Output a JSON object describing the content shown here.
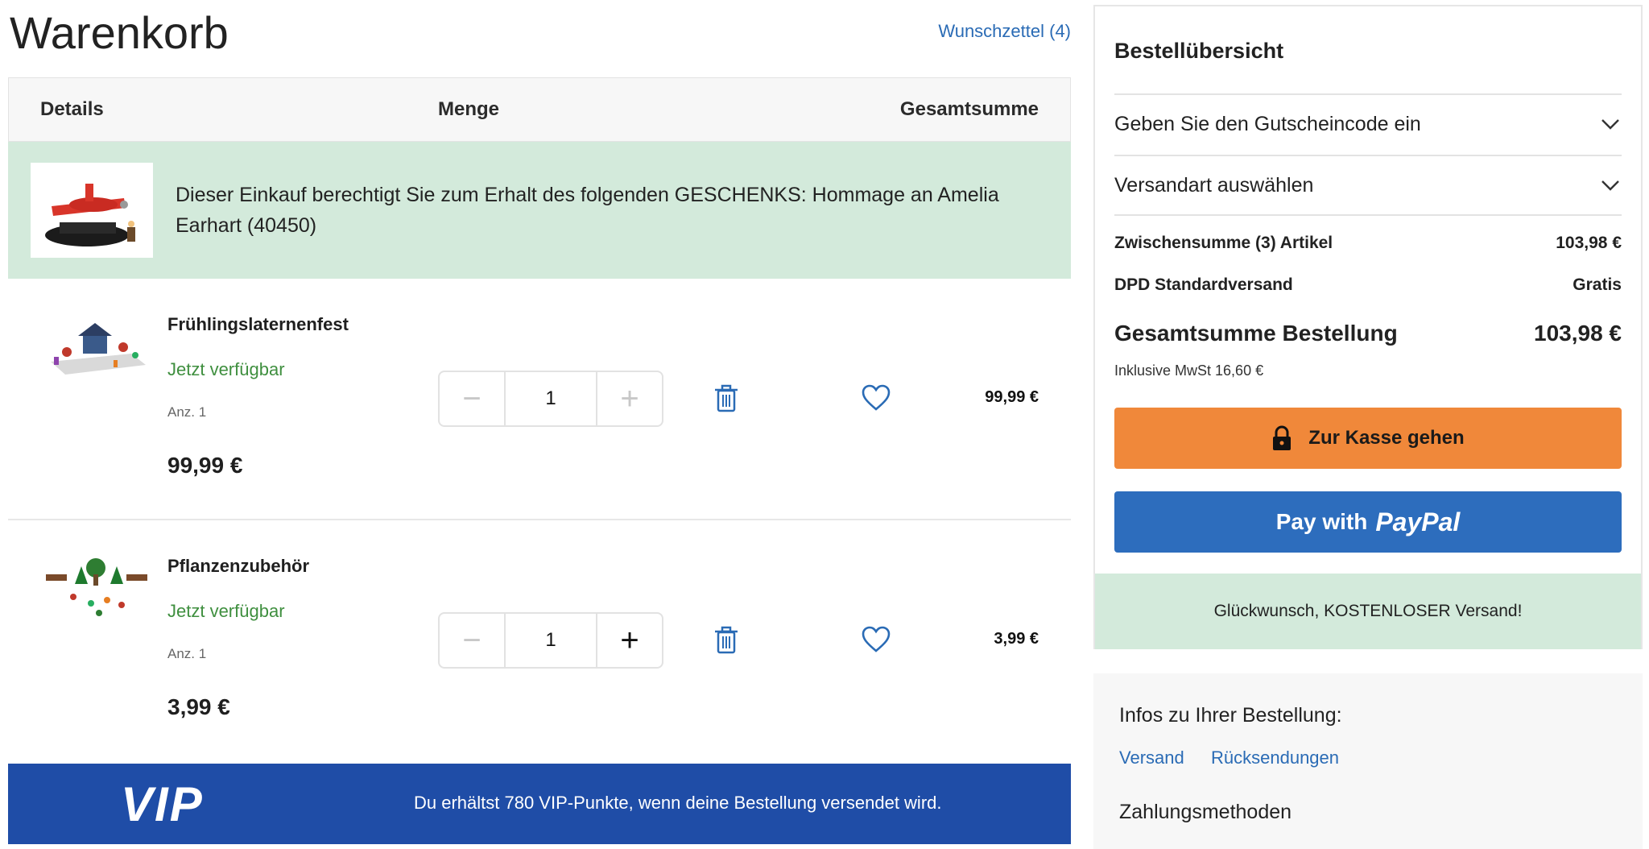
{
  "page": {
    "title": "Warenkorb",
    "wishlist": "Wunschzettel (4)"
  },
  "table": {
    "headers": {
      "details": "Details",
      "quantity": "Menge",
      "total": "Gesamtsumme"
    },
    "gift_banner": "Dieser Einkauf berechtigt Sie zum Erhalt des folgenden GESCHENKS: Hommage an Amelia Earhart (40450)",
    "items": [
      {
        "name": "Frühlingslaternenfest",
        "availability": "Jetzt verfügbar",
        "qty_label": "Anz. 1",
        "price": "99,99 €",
        "quantity": "1",
        "line_total": "99,99 €",
        "minus_enabled": false,
        "plus_enabled": false
      },
      {
        "name": "Pflanzenzubehör",
        "availability": "Jetzt verfügbar",
        "qty_label": "Anz. 1",
        "price": "3,99 €",
        "quantity": "1",
        "line_total": "3,99 €",
        "minus_enabled": false,
        "plus_enabled": true
      }
    ]
  },
  "vip": {
    "logo": "VIP",
    "text": "Du erhältst 780 VIP-Punkte, wenn deine Bestellung versendet wird."
  },
  "summary": {
    "title": "Bestellübersicht",
    "coupon": "Geben Sie den Gutscheincode ein",
    "shipping_select": "Versandart auswählen",
    "subtotal_label": "Zwischensumme (3) Artikel",
    "subtotal_value": "103,98 €",
    "shipping_label": "DPD Standardversand",
    "shipping_value": "Gratis",
    "total_label": "Gesamtsumme Bestellung",
    "total_value": "103,98 €",
    "vat": "Inklusive MwSt 16,60 €",
    "checkout": "Zur Kasse gehen",
    "paypal_prefix": "Pay with",
    "paypal_brand": "PayPal",
    "free_shipping": "Glückwunsch, KOSTENLOSER Versand!"
  },
  "info": {
    "title": "Infos zu Ihrer Bestellung:",
    "links": [
      "Versand",
      "Rücksendungen"
    ],
    "payment_title": "Zahlungsmethoden"
  },
  "colors": {
    "accent_link": "#2a6bb5",
    "success_bg": "#d3eadb",
    "checkout": "#f0883a",
    "paypal": "#2d6dbd",
    "vip": "#1f4da7",
    "available": "#3f8f3f"
  }
}
